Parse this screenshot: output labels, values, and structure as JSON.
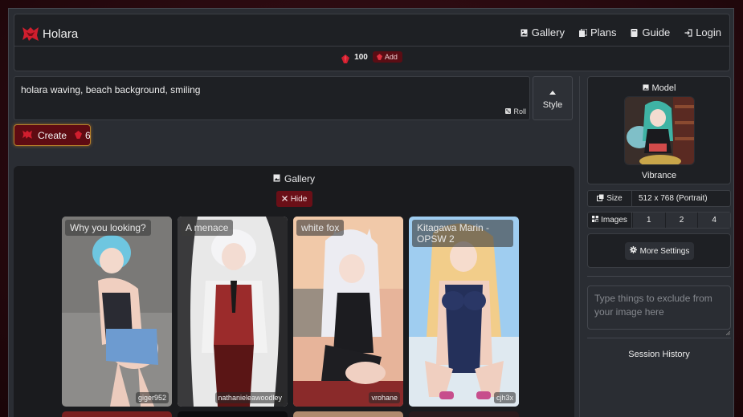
{
  "app": {
    "name": "Holara"
  },
  "nav": [
    {
      "label": "Gallery",
      "icon": "image-icon"
    },
    {
      "label": "Plans",
      "icon": "cards-icon"
    },
    {
      "label": "Guide",
      "icon": "book-icon"
    },
    {
      "label": "Login",
      "icon": "login-icon"
    }
  ],
  "credits": {
    "count": "100",
    "add_label": "Add"
  },
  "prompt": {
    "text": "holara waving, beach background, smiling",
    "roll_label": "Roll"
  },
  "style_button": {
    "label": "Style"
  },
  "create": {
    "label": "Create",
    "cost": "6"
  },
  "gallery": {
    "title": "Gallery",
    "hide_label": "Hide",
    "cards": [
      {
        "title": "Why you looking?",
        "author": "giger952"
      },
      {
        "title": "A menace",
        "author": "nathanieleawoodley"
      },
      {
        "title": "white fox",
        "author": "vrohane"
      },
      {
        "title": "Kitagawa Marin - OPSW 2",
        "author": "cjh3x"
      }
    ]
  },
  "model": {
    "title": "Model",
    "name": "Vibrance"
  },
  "size": {
    "label": "Size",
    "value": "512 x 768 (Portrait)"
  },
  "images": {
    "label": "Images",
    "options": [
      "1",
      "2",
      "4"
    ]
  },
  "more_settings": {
    "label": "More Settings"
  },
  "negative_prompt": {
    "placeholder": "Type things to exclude from your image here"
  },
  "session_history": {
    "label": "Session History"
  },
  "colors": {
    "accent_red": "#5e0b12",
    "gem_red": "#d01e2e",
    "panel": "#1e2024",
    "background": "#2a2d33"
  }
}
